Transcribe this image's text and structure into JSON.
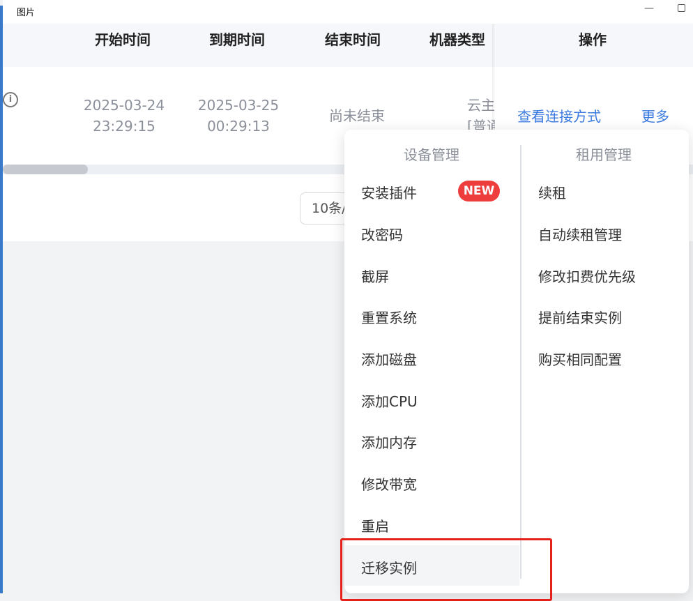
{
  "window": {
    "title": "图片",
    "minimize": "—"
  },
  "table": {
    "headers": [
      "开始时间",
      "到期时间",
      "结束时间",
      "机器类型",
      "操作"
    ],
    "row": {
      "start_date": "2025-03-24",
      "start_time": "23:29:15",
      "expire_date": "2025-03-25",
      "expire_time": "00:29:13",
      "end": "尚未结束",
      "machine_type_line1": "云主",
      "machine_type_line2": "[普通"
    },
    "actions": {
      "connect": "查看连接方式",
      "more": "更多"
    }
  },
  "pagination": {
    "page_size": "10条/"
  },
  "dropdown": {
    "device_heading": "设备管理",
    "device_items": [
      "安装插件",
      "改密码",
      "截屏",
      "重置系统",
      "添加磁盘",
      "添加CPU",
      "添加内存",
      "修改带宽",
      "重启",
      "迁移实例"
    ],
    "new_badge": "NEW",
    "rental_heading": "租用管理",
    "rental_items": [
      "续租",
      "自动续租管理",
      "修改扣费优先级",
      "提前结束实例",
      "购买相同配置"
    ]
  },
  "colors": {
    "link": "#3b7ae0",
    "badge": "#ee3d3d",
    "highlight_box": "#e6211c"
  }
}
